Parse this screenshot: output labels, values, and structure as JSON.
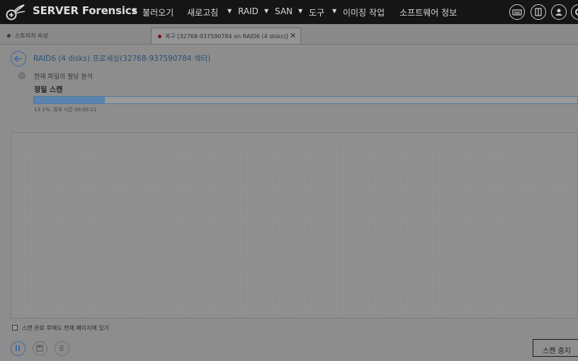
{
  "app": {
    "title": "SERVER Forensics"
  },
  "menu": [
    {
      "label": "불러오기",
      "has_dropdown": true
    },
    {
      "label": "새로고침",
      "has_dropdown": false
    },
    {
      "label": "RAID",
      "has_dropdown": true
    },
    {
      "label": "SAN",
      "has_dropdown": true
    },
    {
      "label": "도구",
      "has_dropdown": true
    },
    {
      "label": "이미징 작업",
      "has_dropdown": true
    },
    {
      "label": "소프트웨어 정보",
      "has_dropdown": false
    }
  ],
  "toolbar_icons": [
    "keyboard-icon",
    "panel-icon",
    "user-icon",
    "settings-icon"
  ],
  "tabs": [
    {
      "label": "스토리지 속성",
      "dot_color": "#3a3a3a",
      "active": false
    },
    {
      "label": "복구 [32768-937590784 on RAID6 (4 disks)]",
      "dot_color": "#7a1010",
      "active": true
    }
  ],
  "page": {
    "title": "RAID6 (4 disks) 프로세싱(32768-937590784 섹터)",
    "status": "현재 파일의 활당 분석",
    "stage": "정밀 스캔",
    "progress_percent": 13.1,
    "progress_text": "13.1%, 경과 시간 00:00:11",
    "stay_on_page_label": "스캔 완료 후에도 현재 페이지에 있기",
    "stay_on_page_checked": false,
    "stop_button": "스캔 중지"
  },
  "colors": {
    "accent": "#3e6a9a",
    "progress": "#5b84b1",
    "topbar": "#151515"
  }
}
